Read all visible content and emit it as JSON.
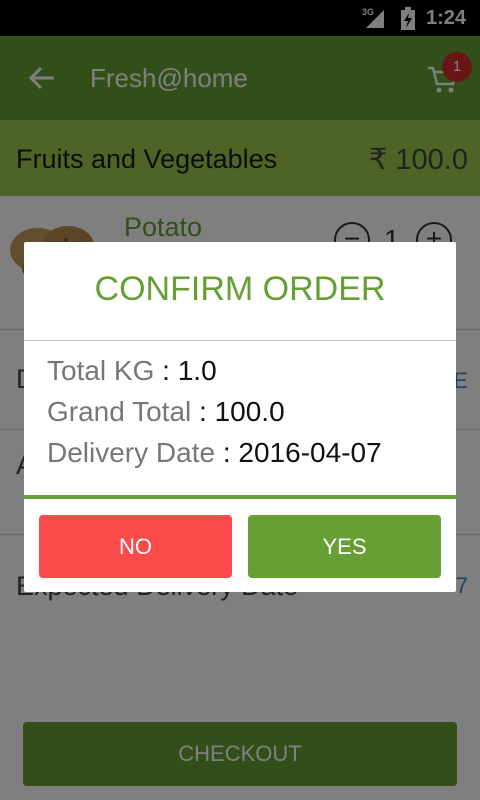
{
  "status_bar": {
    "network": "3G",
    "time": "1:24"
  },
  "app_bar": {
    "title": "Fresh@home",
    "cart_count": "1"
  },
  "category": {
    "name": "Fruits and Vegetables",
    "total": "₹ 100.0"
  },
  "product": {
    "name": "Potato",
    "quantity": "1",
    "minus_label": "−",
    "plus_label": "+"
  },
  "background_rows": {
    "row2_left": "D",
    "row2_right": "E",
    "row3_left": "A",
    "delivery_label": "Expected Delivery Date",
    "delivery_right": "7"
  },
  "checkout": {
    "label": "CHECKOUT"
  },
  "dialog": {
    "title": "CONFIRM ORDER",
    "total_kg_label": "Total KG ",
    "total_kg_value": ": 1.0",
    "grand_total_label": "Grand Total ",
    "grand_total_value": ": 100.0",
    "delivery_date_label": "Delivery Date ",
    "delivery_date_value": ": 2016-04-07",
    "no_label": "NO",
    "yes_label": "YES"
  },
  "colors": {
    "primary_green": "#669f33",
    "category_green": "#9cc84e",
    "no_red": "#fb4a4a",
    "badge_red": "#d42a2a",
    "link_blue": "#3a87c8"
  },
  "icons": {
    "back": "arrow-left-icon",
    "cart": "shopping-cart-icon",
    "signal": "signal-icon",
    "battery": "battery-icon"
  }
}
